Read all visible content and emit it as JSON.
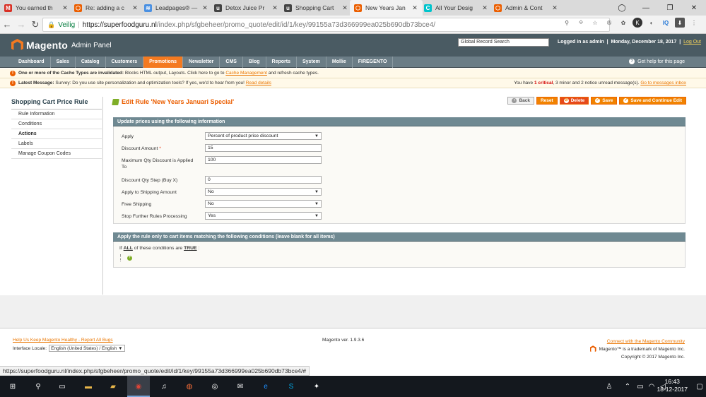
{
  "browser": {
    "tabs": [
      {
        "label": "You earned th",
        "icon": "gmail-icon",
        "color": "#d93025",
        "glyph": "M",
        "active": false
      },
      {
        "label": "Re: adding a c",
        "icon": "magento-icon",
        "color": "#eb5e00",
        "glyph": "⬡",
        "active": false
      },
      {
        "label": "Leadpages® —",
        "icon": "leadpages-icon",
        "color": "#4a90e2",
        "glyph": "≋",
        "active": false
      },
      {
        "label": "Detox Juice Pr",
        "icon": "u-icon",
        "color": "#444",
        "glyph": "u",
        "active": false
      },
      {
        "label": "Shopping Cart",
        "icon": "u-icon",
        "color": "#444",
        "glyph": "u",
        "active": false
      },
      {
        "label": "New Years Jan",
        "icon": "magento-icon",
        "color": "#eb5e00",
        "glyph": "⬡",
        "active": true
      },
      {
        "label": "All Your Desig",
        "icon": "canva-icon",
        "color": "#00c4cc",
        "glyph": "C",
        "active": false
      },
      {
        "label": "Admin & Cont",
        "icon": "magento-icon",
        "color": "#eb5e00",
        "glyph": "⬡",
        "active": false
      }
    ],
    "secure_label": "Veilig",
    "url_host": "https://superfoodguru.nl",
    "url_path": "/index.php/sfgbeheer/promo_quote/edit/id/1/key/99155a73d366999ea025b690db73bce4/",
    "status_url": "https://superfoodguru.nl/index.php/sfgbeheer/promo_quote/edit/id/1/key/99155a73d366999ea025b690db73bce4/#"
  },
  "header": {
    "brand": "Magento",
    "subtitle": "Admin Panel",
    "global_search_placeholder": "Global Record Search",
    "logged_in": "Logged in as admin",
    "date": "Monday, December 18, 2017",
    "log_out": "Log Out"
  },
  "nav": {
    "items": [
      "Dashboard",
      "Sales",
      "Catalog",
      "Customers",
      "Promotions",
      "Newsletter",
      "CMS",
      "Blog",
      "Reports",
      "System",
      "Mollie",
      "FIREGENTO"
    ],
    "active_index": 4,
    "help": "Get help for this page"
  },
  "notices": {
    "cache": {
      "bold": "One or more of the Cache Types are invalidated:",
      "text": "Blocks HTML output, Layouts. Click here to go to",
      "link": "Cache Management",
      "tail": "and refresh cache types."
    },
    "latest": {
      "bold": "Latest Message:",
      "text": "Survey: Do you use site personalization and optimization tools? If yes, we'd to hear from you!",
      "link": "Read details",
      "right_prefix": "You have",
      "critical": "1 critical",
      "right_mid": ", 3 minor and 2 notice unread message(s).",
      "right_link": "Go to messages inbox"
    }
  },
  "sidebar": {
    "title": "Shopping Cart Price Rule",
    "items": [
      "Rule Information",
      "Conditions",
      "Actions",
      "Labels",
      "Manage Coupon Codes"
    ],
    "active_index": 2
  },
  "page": {
    "title": "Edit Rule 'New Years Januari Special'",
    "buttons": {
      "back": "Back",
      "reset": "Reset",
      "delete": "Delete",
      "save": "Save",
      "save_continue": "Save and Continue Edit"
    }
  },
  "actions_form": {
    "section_title": "Update prices using the following information",
    "apply_label": "Apply",
    "apply_value": "Percent of product price discount",
    "discount_amount_label": "Discount Amount",
    "discount_amount_required": "*",
    "discount_amount_value": "15",
    "max_qty_label": "Maximum Qty Discount is Applied To",
    "max_qty_value": "100",
    "qty_step_label": "Discount Qty Step (Buy X)",
    "qty_step_value": "0",
    "apply_shipping_label": "Apply to Shipping Amount",
    "apply_shipping_value": "No",
    "free_shipping_label": "Free Shipping",
    "free_shipping_value": "No",
    "stop_rules_label": "Stop Further Rules Processing",
    "stop_rules_value": "Yes"
  },
  "conditions": {
    "section_title": "Apply the rule only to cart items matching the following conditions (leave blank for all items)",
    "if": "If",
    "aggregator": "ALL",
    "middle": "of these conditions are",
    "value": "TRUE",
    "colon": ":"
  },
  "footer": {
    "help_link": "Help Us Keep Magento Healthy - Report All Bugs",
    "locale_label": "Interface Locale:",
    "locale_value": "English (United States) / English",
    "version": "Magento ver. 1.9.3.6",
    "community_link": "Connect with the Magento Community",
    "trademark": "Magento™ is a trademark of Magento Inc.",
    "copyright": "Copyright © 2017 Magento Inc."
  },
  "taskbar": {
    "time": "16:43",
    "date": "18-12-2017"
  },
  "colors": {
    "accent": "#eb5e00",
    "header_bg": "#4a5b63",
    "nav_bg": "#6b7d86",
    "section_bg": "#6f8992"
  }
}
